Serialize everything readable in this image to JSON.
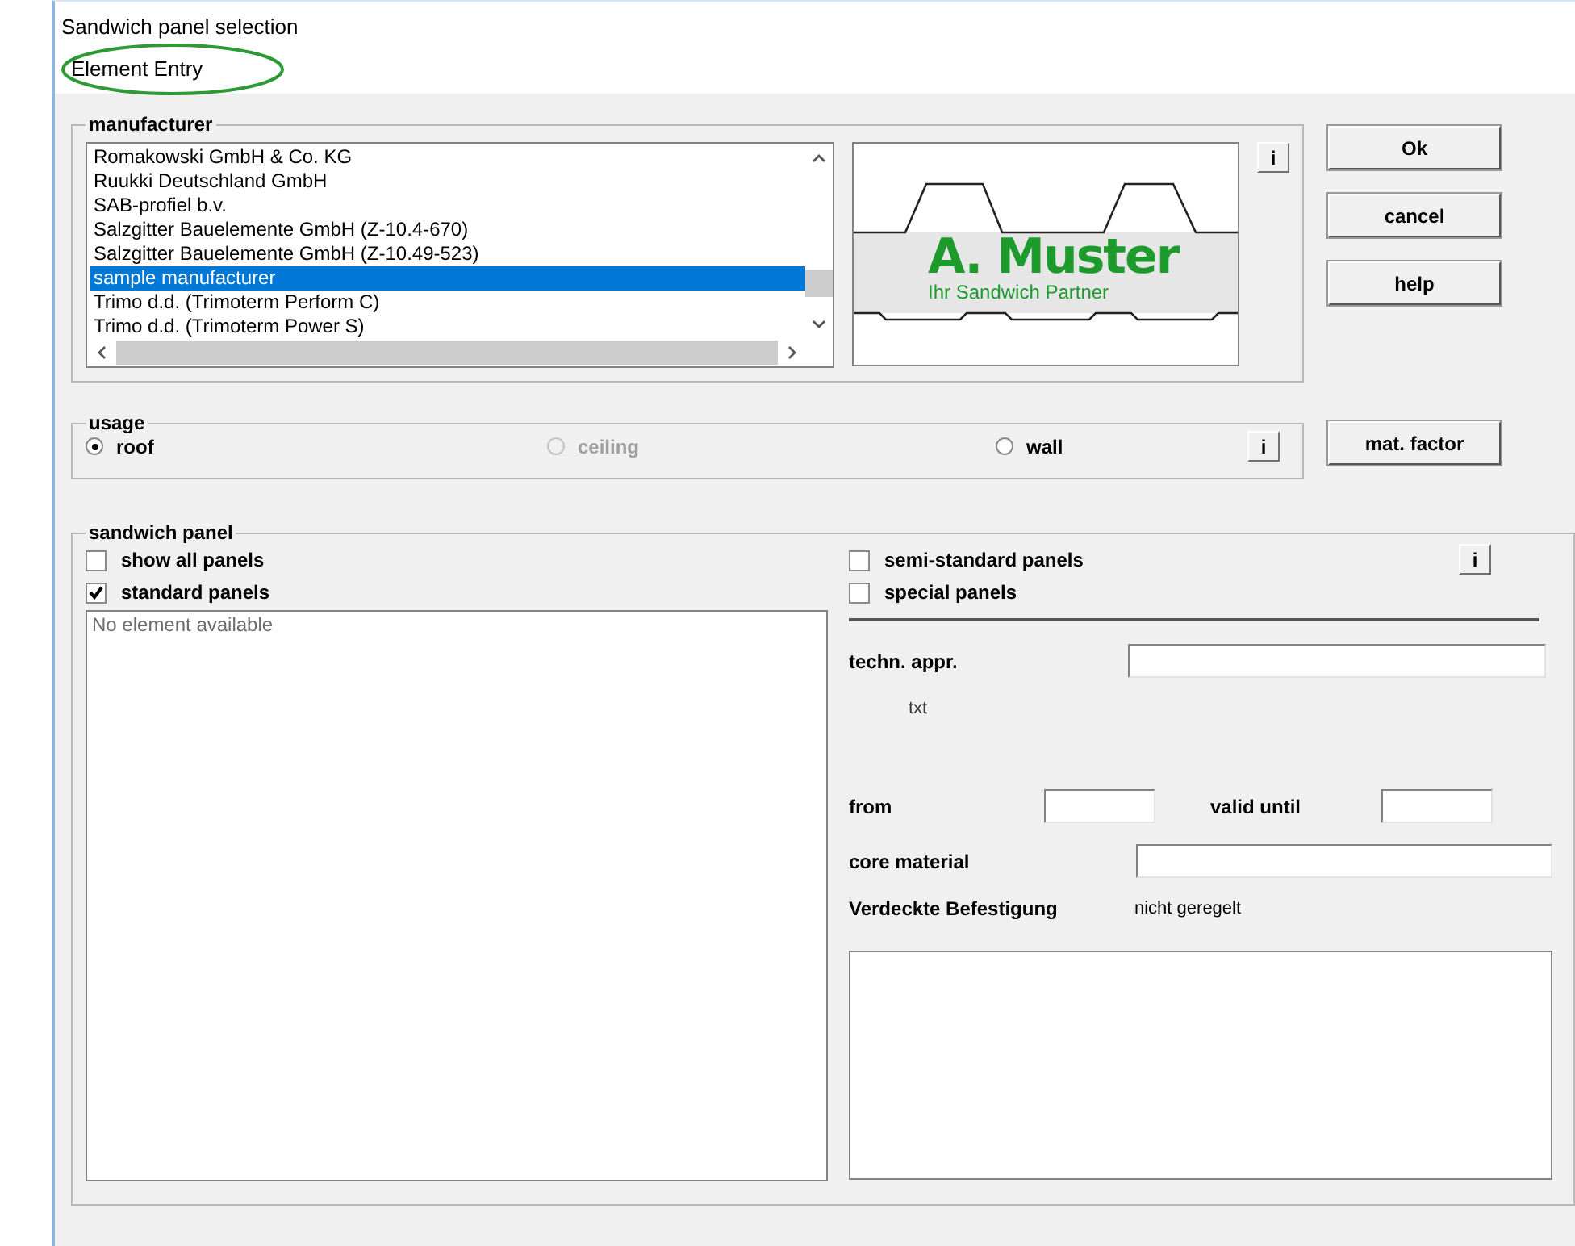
{
  "window": {
    "title": "Sandwich panel selection",
    "subtitle": "Element Entry"
  },
  "manufacturer": {
    "label": "manufacturer",
    "info_button": "i",
    "items": [
      {
        "text": "Romakowski GmbH & Co. KG",
        "selected": false
      },
      {
        "text": "Ruukki Deutschland GmbH",
        "selected": false
      },
      {
        "text": "SAB-profiel b.v.",
        "selected": false
      },
      {
        "text": "Salzgitter Bauelemente GmbH (Z-10.4-670)",
        "selected": false
      },
      {
        "text": "Salzgitter Bauelemente GmbH (Z-10.49-523)",
        "selected": false
      },
      {
        "text": "sample manufacturer",
        "selected": true
      },
      {
        "text": "Trimo d.d. (Trimoterm Perform C)",
        "selected": false
      },
      {
        "text": "Trimo d.d. (Trimoterm Power S)",
        "selected": false
      }
    ],
    "preview": {
      "title": "A. Muster",
      "subtitle": "Ihr Sandwich Partner"
    }
  },
  "buttons": [
    {
      "label": "Ok"
    },
    {
      "label": "cancel"
    },
    {
      "label": "help"
    }
  ],
  "usage": {
    "label": "usage",
    "info_button": "i",
    "options": [
      {
        "label": "roof",
        "selected": true,
        "disabled": false
      },
      {
        "label": "ceiling",
        "selected": false,
        "disabled": true
      },
      {
        "label": "wall",
        "selected": false,
        "disabled": false
      }
    ]
  },
  "mat_factor_button": {
    "label": "mat. factor"
  },
  "sandwich_panel": {
    "label": "sandwich panel",
    "info_button": "i",
    "left_checks": [
      {
        "label": "show all panels",
        "checked": false
      },
      {
        "label": "standard panels",
        "checked": true
      }
    ],
    "right_checks": [
      {
        "label": "semi-standard panels",
        "checked": false
      },
      {
        "label": "special panels",
        "checked": false
      }
    ],
    "panel_list": {
      "empty_text": "No element available"
    },
    "techn_appr": {
      "label": "techn. appr.",
      "note": "txt"
    },
    "from": {
      "label": "from"
    },
    "valid_until": {
      "label": "valid until"
    },
    "core_material": {
      "label": "core material"
    },
    "fastening": {
      "label": "Verdeckte Befestigung",
      "value": "nicht geregelt"
    }
  }
}
